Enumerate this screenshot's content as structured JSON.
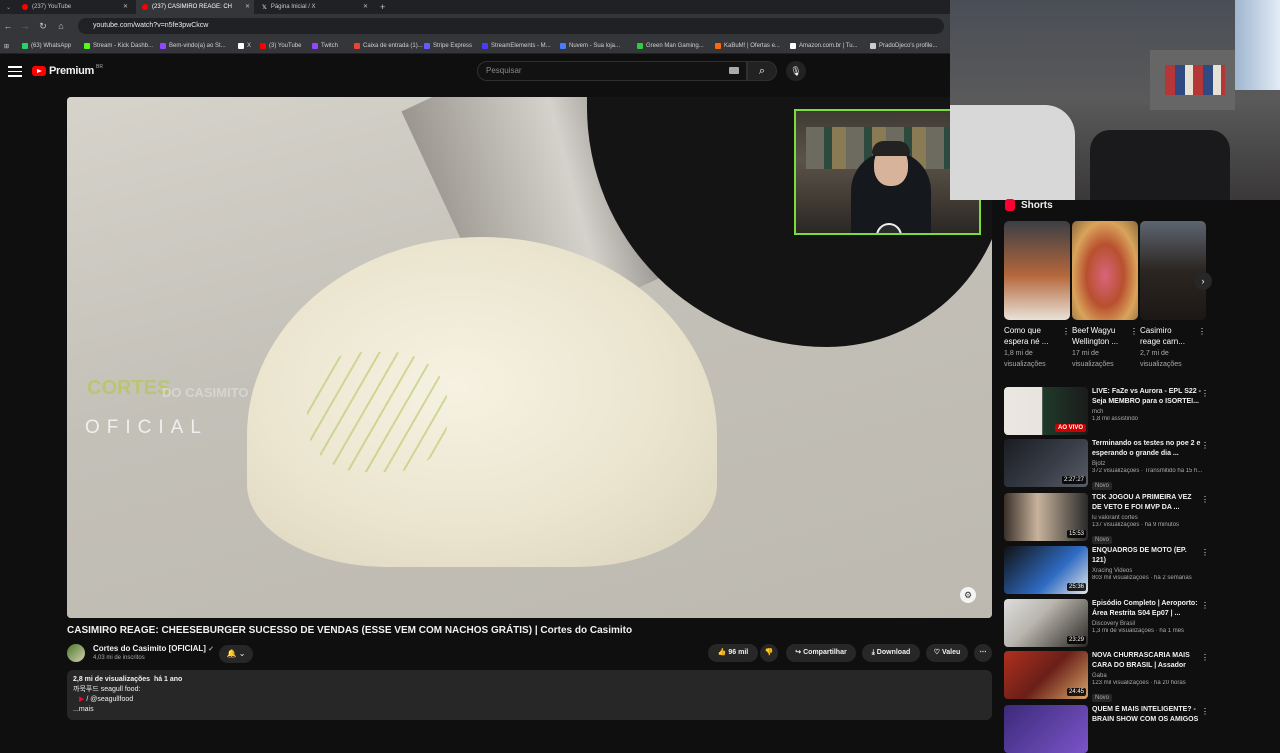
{
  "browser": {
    "tabs": [
      {
        "title": "(237) YouTube",
        "active": false
      },
      {
        "title": "(237) CASIMIRO REAGE: CH",
        "active": true
      },
      {
        "title": "Página Inicial / X",
        "active": false
      }
    ],
    "url": "youtube.com/watch?v=n5fe3pwCkcw",
    "bookmarks": [
      "(63) WhatsApp",
      "Stream - Kick Dashb...",
      "Bem-vindo(a) ao St...",
      "X",
      "(3) YouTube",
      "Twitch",
      "Caixa de entrada (1)...",
      "Stripe Express",
      "StreamElements - M...",
      "Nuvem - Sua loja...",
      "Green Man Gaming...",
      "KaBuM! | Ofertas e...",
      "Amazon.com.br | Tu...",
      "PradoDjeco's profile..."
    ]
  },
  "header": {
    "logo": "Premium",
    "country": "BR",
    "search_placeholder": "Pesquisar"
  },
  "player": {
    "watermark_top": "CORTES",
    "watermark_do": "DO CASIMITO",
    "watermark_bottom": "OFICIAL"
  },
  "video": {
    "title": "CASIMIRO REAGE: CHEESEBURGER SUCESSO DE VENDAS (ESSE VEM COM NACHOS GRÁTIS) | Cortes do Casimito",
    "channel": "Cortes do Casimito [OFICIAL]",
    "subscribers": "4,03 mi de inscritos",
    "likes": "96 mil",
    "share": "Compartilhar",
    "download": "Download",
    "thanks": "Valeu",
    "desc_views": "2,8 mi de visualizações",
    "desc_date": "há 1 ano",
    "desc_line1": "까묵푸드 seagull food:",
    "desc_line2": "/ @seagullfood",
    "desc_more": "...mais"
  },
  "shorts": {
    "heading": "Shorts",
    "items": [
      {
        "title": "Como que espera né ...",
        "views": "1,8 mi de visualizações"
      },
      {
        "title": "Beef Wagyu Wellington ...",
        "views": "17 mi de visualizações"
      },
      {
        "title": "Casimiro reage carn...",
        "views": "2,7 mi de visualizações"
      }
    ]
  },
  "recommendations": [
    {
      "title": "LIVE: FaZe vs Aurora - EPL S22 - Seja MEMBRO para o ISORTEI...",
      "channel": "mch",
      "meta": "1,8 mil assistindo",
      "duration": "AO VIVO",
      "live": true,
      "badge": ""
    },
    {
      "title": "Terminando os testes no poe 2 e esperando o grande dia ...",
      "channel": "Bjotz",
      "meta": "372 visualizações · Transmitido há 15 h...",
      "duration": "2:27:27",
      "live": false,
      "badge": "Novo"
    },
    {
      "title": "TCK JOGOU A PRIMEIRA VEZ DE VETO E FOI MVP DA ...",
      "channel": "lu valorant cortes",
      "meta": "137 visualizações · há 9 minutos",
      "duration": "15:53",
      "live": false,
      "badge": "Novo"
    },
    {
      "title": "ENQUADROS DE MOTO (EP. 121)",
      "channel": "Xracing Videos",
      "meta": "803 mil visualizações · há 2 semanas",
      "duration": "25:36",
      "live": false,
      "badge": ""
    },
    {
      "title": "Episódio Completo | Aeroporto: Área Restrita S04 Ep07 | ...",
      "channel": "Discovery Brasil",
      "meta": "1,3 mi de visualizações · há 1 mês",
      "duration": "23:29",
      "live": false,
      "badge": ""
    },
    {
      "title": "NOVA CHURRASCARIA MAIS CARA DO BRASIL | Assador",
      "channel": "Gaba",
      "meta": "123 mil visualizações · há 20 horas",
      "duration": "24:45",
      "live": false,
      "badge": "Novo"
    },
    {
      "title": "QUEM É MAIS INTELIGENTE? - BRAIN SHOW COM OS AMIGOS",
      "channel": "",
      "meta": "",
      "duration": "",
      "live": false,
      "badge": ""
    }
  ],
  "colors": {
    "accent": "#ff0000",
    "cam_border": "#7bdc3a",
    "bg": "#0f0f0f"
  }
}
